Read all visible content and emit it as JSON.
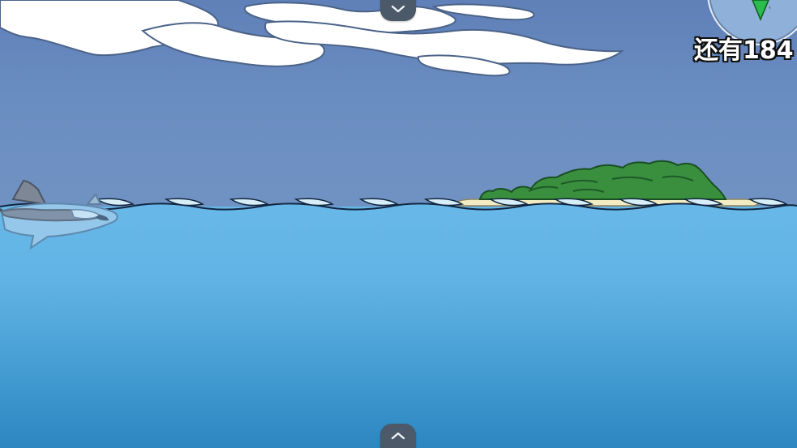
{
  "hud": {
    "distance_prefix": "还有",
    "distance_value": "184"
  },
  "controls": {
    "top_arrow": "chevron-down-icon",
    "bottom_arrow": "chevron-up-icon"
  },
  "colors": {
    "sky_top": "#5f80b8",
    "sky_mid": "#6f93c3",
    "sea_top": "#67b8e8",
    "sea_bottom": "#2d86c0",
    "island_green": "#2f8b3d",
    "sand": "#f3ecc2",
    "tab_dark": "#4b5968"
  }
}
